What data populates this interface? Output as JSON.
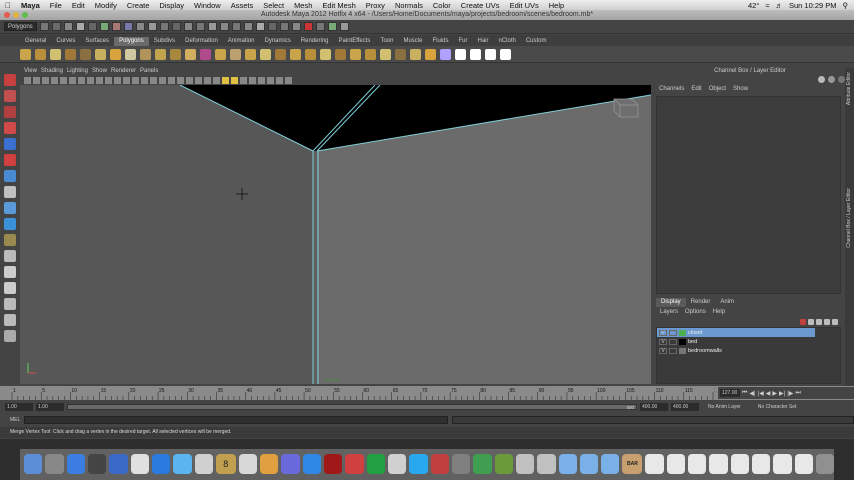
{
  "menubar": {
    "app": "Maya",
    "items": [
      "File",
      "Edit",
      "Modify",
      "Create",
      "Display",
      "Window",
      "Assets",
      "Select",
      "Mesh",
      "Edit Mesh",
      "Proxy",
      "Normals",
      "Color",
      "Create UVs",
      "Edit UVs",
      "Help"
    ],
    "battery": "42°",
    "clock": "Sun 10:29 PM"
  },
  "window": {
    "title": "Autodesk Maya 2012 Hotfix 4 x64 - /Users/Home/Documents/maya/projects/bedroom/scenes/bedroom.mb*"
  },
  "statusline": {
    "menu_set": "Polygons"
  },
  "shelf": {
    "tabs": [
      "General",
      "Curves",
      "Surfaces",
      "Polygons",
      "Subdivs",
      "Deformation",
      "Animation",
      "Dynamics",
      "Rendering",
      "PaintEffects",
      "Toon",
      "Muscle",
      "Fluids",
      "Fur",
      "Hair",
      "nCloth",
      "Custom"
    ],
    "active_tab": "Polygons",
    "icon_colors": [
      "#c9a44a",
      "#b88f3a",
      "#d0c070",
      "#a07838",
      "#8a7040",
      "#c8b060",
      "#d9a33e",
      "#cfc8a0",
      "#b0945a",
      "#c2a44e",
      "#a8883c",
      "#d0b060",
      "#b04a8a",
      "#c9a44a",
      "#bba070",
      "#c9a44a",
      "#d0c070",
      "#a07838",
      "#c9a44a",
      "#b88f3a",
      "#d0c070",
      "#a07838",
      "#c9a44a",
      "#b88f3a",
      "#d0c070",
      "#8a7040",
      "#c8b060",
      "#d9a33e",
      "#b0a0ff",
      "#ffffff",
      "#ffffff",
      "#ffffff",
      "#ffffff"
    ]
  },
  "panel": {
    "menus": [
      "View",
      "Shading",
      "Lighting",
      "Show",
      "Renderer",
      "Panels"
    ]
  },
  "channel_box": {
    "title": "Channel Box / Layer Editor",
    "menus": [
      "Channels",
      "Edit",
      "Object",
      "Show"
    ],
    "side_tabs": [
      "Attribute Editor",
      "Channel Box / Layer Editor"
    ]
  },
  "layer_editor": {
    "tabs": [
      "Display",
      "Render",
      "Anim"
    ],
    "active_tab": "Display",
    "menus": [
      "Layers",
      "Options",
      "Help"
    ],
    "layers": [
      {
        "name": "closet",
        "vis": "V",
        "color": "#4caf50",
        "selected": true
      },
      {
        "name": "bed",
        "vis": "V",
        "color": "#000000",
        "selected": false
      },
      {
        "name": "bedroomwalls",
        "vis": "V",
        "color": "#777777",
        "selected": false
      }
    ]
  },
  "time_slider": {
    "ticks": [
      "1",
      "5",
      "10",
      "15",
      "20",
      "25",
      "30",
      "35",
      "40",
      "45",
      "50",
      "55",
      "60",
      "65",
      "70",
      "75",
      "80",
      "85",
      "90",
      "95",
      "100",
      "105",
      "110",
      "115",
      "120"
    ],
    "current_frame": "127.00"
  },
  "range_slider": {
    "start": "1.00",
    "start_inner": "1.00",
    "end_inner": "400.00",
    "end": "400.00",
    "range_label": "400",
    "anim_layer": "No Anim Layer",
    "char_set": "No Character Set"
  },
  "command_line": {
    "label": "MEL"
  },
  "help_line": "Merge Vertex Tool: Click and drag a vertex in the desired target. All selected vertices will be merged.",
  "dock": {
    "icon_colors": [
      "#5a8fd8",
      "#888888",
      "#3b7de0",
      "#444444",
      "#3a6ac8",
      "#e0e0e0",
      "#2a7ae0",
      "#5ab4f0",
      "#d0d0d0",
      "#c0a050",
      "#d8d8d8",
      "#e0a040",
      "#6a6adc",
      "#2f87e6",
      "#a01818",
      "#d04040",
      "#20a040",
      "#d0d0d0",
      "#2aa8ef",
      "#c04040",
      "#808080",
      "#3f9e4f",
      "#6a9a3a",
      "#c0c0c0",
      "#c0c0c0",
      "#7ab0e8",
      "#7ab0e8",
      "#7ab0e8",
      "#c8a070",
      "#e8e8e8",
      "#e8e8e8",
      "#e8e8e8",
      "#e8e8e8",
      "#e8e8e8",
      "#e8e8e8",
      "#e8e8e8",
      "#e8e8e8",
      "#909090"
    ],
    "calendar_day": "8",
    "bar_label": "BAR"
  }
}
